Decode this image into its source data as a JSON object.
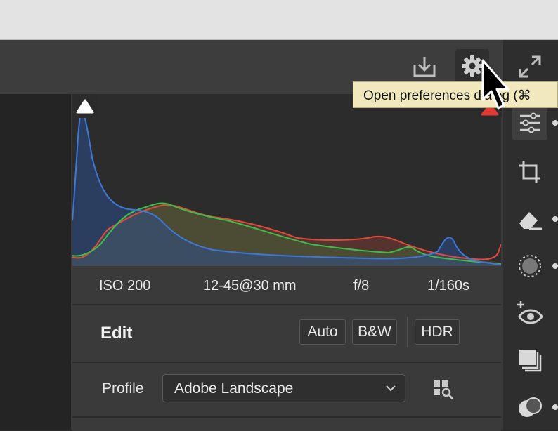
{
  "tooltip": {
    "text": "Open preferences dialog (⌘"
  },
  "header": {
    "icons": [
      "save-download-icon",
      "gear-icon",
      "expand-icon"
    ]
  },
  "histogram": {
    "colors": {
      "red": "#e24a3b",
      "green": "#3bbf4a",
      "blue": "#3d78d8"
    }
  },
  "meta": {
    "iso": "ISO 200",
    "lens": "12-45@30 mm",
    "aperture": "f/8",
    "shutter": "1/160s"
  },
  "edit": {
    "title": "Edit",
    "auto_label": "Auto",
    "bw_label": "B&W",
    "hdr_label": "HDR"
  },
  "profile": {
    "label": "Profile",
    "selected": "Adobe Landscape"
  },
  "sidebar_tools": [
    "edit-sliders-icon",
    "crop-rotate-icon",
    "eraser-heal-icon",
    "masking-icon",
    "red-eye-icon",
    "presets-icon",
    "snapshots-icon"
  ]
}
